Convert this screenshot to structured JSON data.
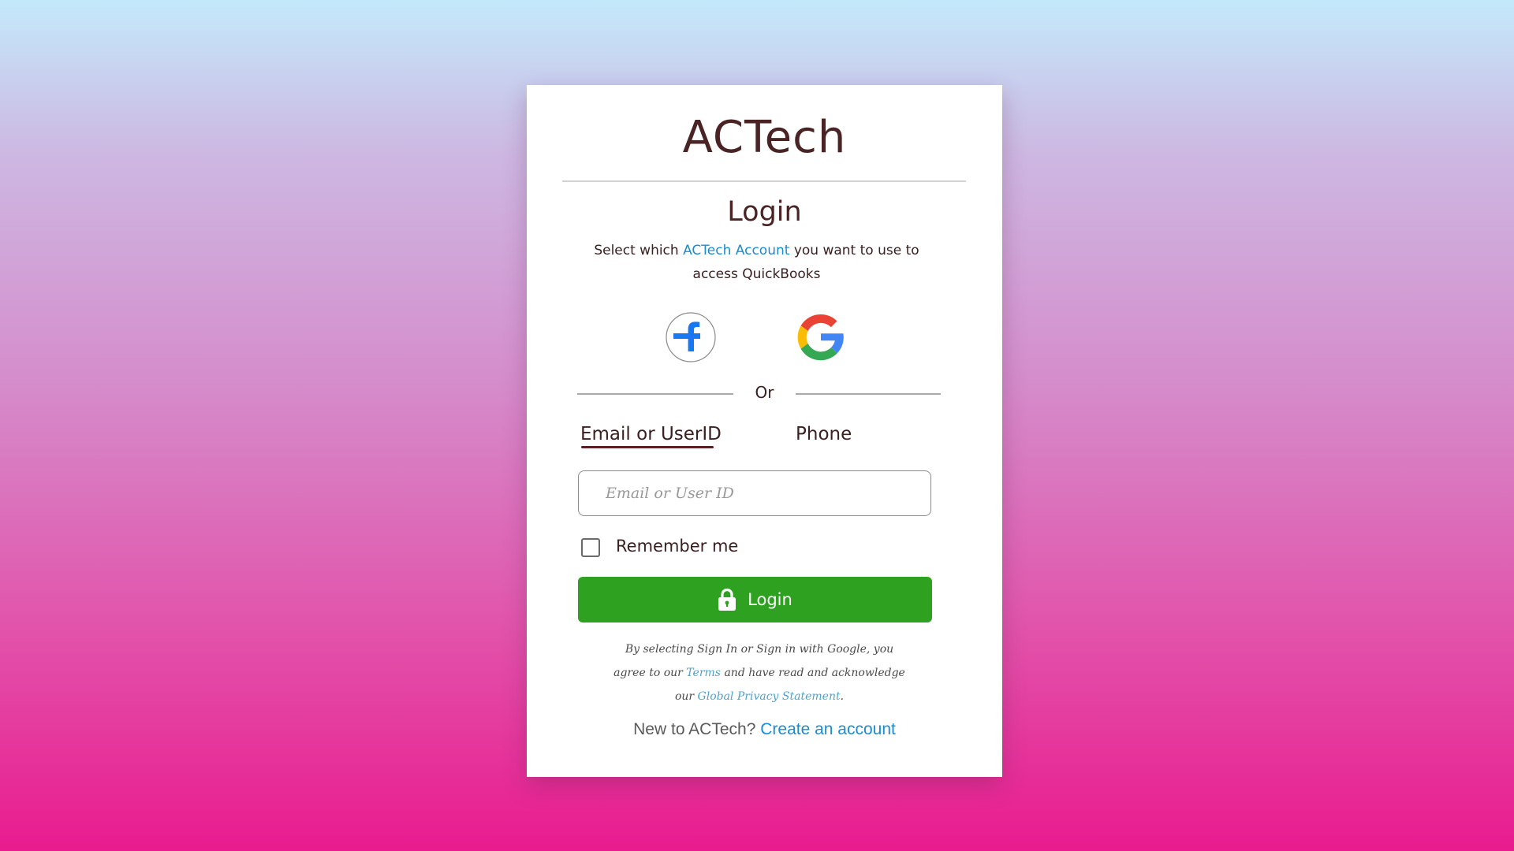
{
  "brand": {
    "name": "ACTech"
  },
  "login": {
    "heading": "Login",
    "subtitle_prefix": "Select which ",
    "subtitle_link": "ACTech Account",
    "subtitle_suffix": " you want to use to access QuickBooks",
    "social": [
      {
        "name": "facebook",
        "icon": "facebook-icon",
        "color": "#1877f2"
      },
      {
        "name": "google",
        "icon": "google-icon",
        "colors": [
          "#4285f4",
          "#ea4335",
          "#fbbc05",
          "#34a853"
        ]
      }
    ],
    "divider_text": "Or",
    "tabs": [
      {
        "label": "Email or UserID",
        "active": true
      },
      {
        "label": "Phone",
        "active": false
      }
    ],
    "email_input": {
      "placeholder": "Email or User ID",
      "value": ""
    },
    "remember_me": {
      "label": "Remember me",
      "checked": false
    },
    "login_button": {
      "label": "Login",
      "icon": "lock-icon",
      "color": "#2ea120"
    },
    "legal": {
      "prefix": "By selecting Sign In or Sign in with Google, you agree to our ",
      "terms_link": "Terms",
      "middle": " and have read and acknowledge our ",
      "privacy_link": "Global Privacy Statement",
      "suffix": "."
    },
    "signup": {
      "prompt": "New to ACTech? ",
      "link": "Create an account"
    }
  },
  "colors": {
    "text_dark": "#4a2424",
    "link_blue": "#1a8ccf",
    "background_top": "#c4e9fb",
    "background_bottom": "#e91b8e"
  }
}
